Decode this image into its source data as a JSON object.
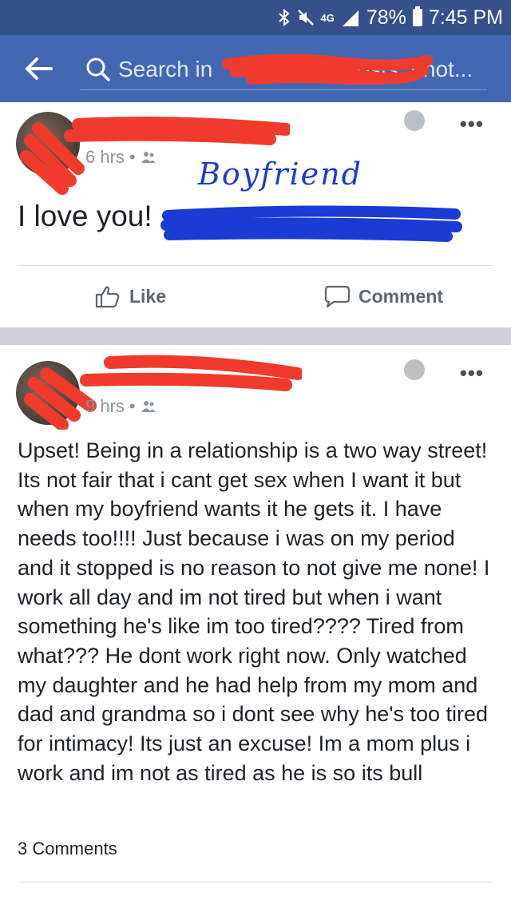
{
  "status_bar": {
    "network_label": "4G",
    "battery": "78%",
    "time": "7:45 PM"
  },
  "search": {
    "placeholder_start": "Search in",
    "placeholder_end": "posts, phot..."
  },
  "posts": [
    {
      "timestamp": "6 hrs",
      "text": "I love you!",
      "annotation": "Boyfriend",
      "like_label": "Like",
      "comment_label": "Comment"
    },
    {
      "timestamp": "9 hrs",
      "text": "Upset! Being in a relationship is a two way street! Its not fair that i cant get sex when I want it but when my boyfriend wants it he gets it. I have needs too!!!! Just because i was on my period and it stopped is no reason to not give me none! I work all day and im not tired but when i want something he's like im too tired???? Tired from what??? He dont work right now. Only watched my daughter and he had help from my mom and dad and grandma so i dont see why he's too tired for intimacy! Its just an excuse! Im a mom plus i work and im not as tired as he is so its bull",
      "comment_count": "3 Comments"
    }
  ],
  "colors": {
    "status_bar": "#35508a",
    "header": "#4267b2",
    "redaction_red": "#f03a2c",
    "redaction_blue": "#1a3bd4"
  }
}
